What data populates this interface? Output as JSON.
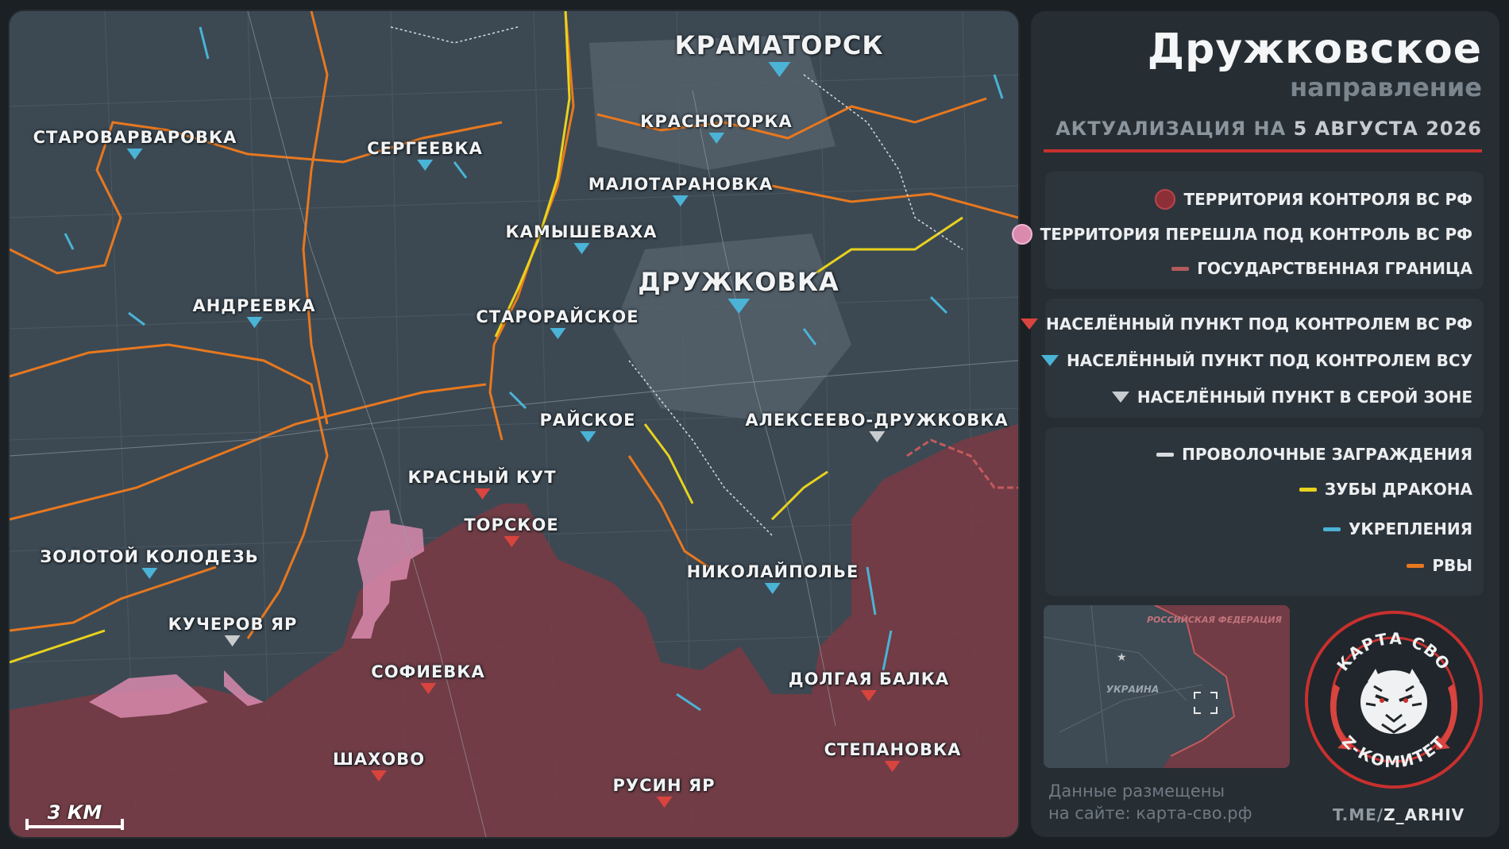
{
  "header": {
    "title": "Дружковское",
    "subtitle": "направление",
    "update_prefix": "АКТУАЛИЗАЦИЯ НА",
    "update_date": "5 АВГУСТА 2026"
  },
  "legend": {
    "territory": [
      {
        "label": "ТЕРРИТОРИЯ КОНТРОЛЯ ВС РФ",
        "color": "#8c2f36"
      },
      {
        "label": "ТЕРРИТОРИЯ ПЕРЕШЛА ПОД КОНТРОЛЬ ВС РФ",
        "color": "#d98aae"
      },
      {
        "label": "ГОСУДАРСТВЕННАЯ ГРАНИЦА",
        "color": "#b55a5c"
      }
    ],
    "settlements": [
      {
        "label": "НАСЕЛЁННЫЙ ПУНКТ ПОД КОНТРОЛЕМ ВС РФ",
        "color": "#d8443e"
      },
      {
        "label": "НАСЕЛЁННЫЙ ПУНКТ ПОД КОНТРОЛЕМ ВСУ",
        "color": "#4ab3d6"
      },
      {
        "label": "НАСЕЛЁННЫЙ ПУНКТ В СЕРОЙ ЗОНЕ",
        "color": "#c9ccce"
      }
    ],
    "fortifications": [
      {
        "label": "ПРОВОЛОЧНЫЕ ЗАГРАЖДЕНИЯ",
        "color": "#d9dcde"
      },
      {
        "label": "ЗУБЫ ДРАКОНА",
        "color": "#e8d21d"
      },
      {
        "label": "УКРЕПЛЕНИЯ",
        "color": "#4ab3d6"
      },
      {
        "label": "РВЫ",
        "color": "#e8781e"
      }
    ]
  },
  "map": {
    "scale_label": "3 КМ",
    "settlements": [
      {
        "name": "КРАМАТОРСК",
        "status": "ua",
        "size": "big"
      },
      {
        "name": "КРАСНОТОРКА",
        "status": "ua",
        "size": "small"
      },
      {
        "name": "СТАРОВАРВАРОВКА",
        "status": "ua",
        "size": "small"
      },
      {
        "name": "СЕРГЕЕВКА",
        "status": "ua",
        "size": "small"
      },
      {
        "name": "МАЛОТАРАНОВКА",
        "status": "ua",
        "size": "small"
      },
      {
        "name": "КАМЫШЕВАХА",
        "status": "ua",
        "size": "small"
      },
      {
        "name": "ДРУЖКОВКА",
        "status": "ua",
        "size": "big"
      },
      {
        "name": "АНДРЕЕВКА",
        "status": "ua",
        "size": "small"
      },
      {
        "name": "СТАРОРАЙСКОЕ",
        "status": "ua",
        "size": "small"
      },
      {
        "name": "РАЙСКОЕ",
        "status": "ua",
        "size": "small"
      },
      {
        "name": "АЛЕКСЕЕВО-ДРУЖКОВКА",
        "status": "grey",
        "size": "small"
      },
      {
        "name": "КРАСНЫЙ КУТ",
        "status": "ru",
        "size": "small"
      },
      {
        "name": "ТОРСКОЕ",
        "status": "ru",
        "size": "small"
      },
      {
        "name": "ЗОЛОТОЙ КОЛОДЕЗЬ",
        "status": "ua",
        "size": "small"
      },
      {
        "name": "НИКОЛАЙПОЛЬЕ",
        "status": "ua",
        "size": "small"
      },
      {
        "name": "КУЧЕРОВ ЯР",
        "status": "grey",
        "size": "small"
      },
      {
        "name": "СОФИЕВКА",
        "status": "ru",
        "size": "small"
      },
      {
        "name": "ДОЛГАЯ БАЛКА",
        "status": "ru",
        "size": "small"
      },
      {
        "name": "СТЕПАНОВКА",
        "status": "ru",
        "size": "small"
      },
      {
        "name": "ШАХОВО",
        "status": "ru",
        "size": "small"
      },
      {
        "name": "РУСИН ЯР",
        "status": "ru",
        "size": "small"
      }
    ]
  },
  "inset": {
    "label_russia": "РОССИЙСКАЯ ФЕДЕРАЦИЯ",
    "label_ukraine": "УКРАИНА"
  },
  "footer": {
    "source_line1": "Данные размещены",
    "source_line2": "на сайте: карта-сво.рф",
    "tg_prefix": "T.ME/",
    "tg_handle": "Z_ARHIV",
    "logo_top": "КАРТА СВО",
    "logo_bottom": "Z-КОМИТЕТ"
  }
}
